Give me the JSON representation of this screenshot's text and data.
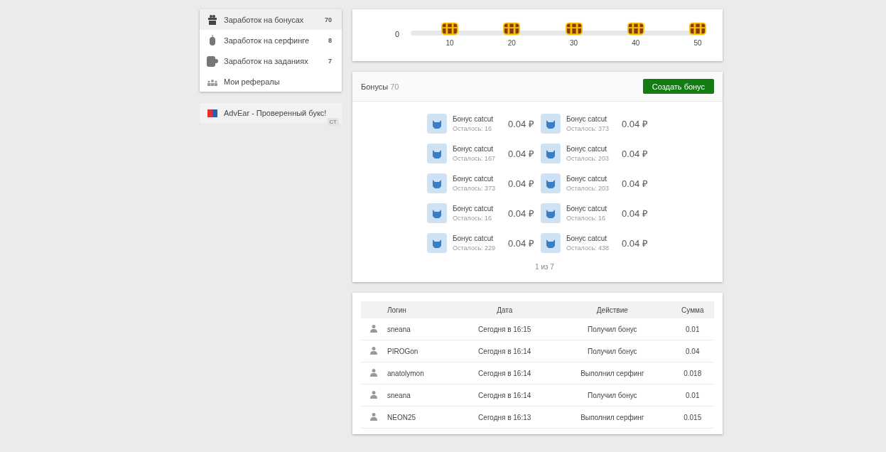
{
  "sidebar": {
    "items": [
      {
        "kind": "gift",
        "label": "Заработок на бонусах",
        "count": "70",
        "selected": true
      },
      {
        "kind": "mouse",
        "label": "Заработок на серфинге",
        "count": "8",
        "selected": false
      },
      {
        "kind": "cup",
        "label": "Заработок на заданиях",
        "count": "7",
        "selected": false
      },
      {
        "kind": "people",
        "label": "Мои рефералы",
        "selected": false
      }
    ]
  },
  "ad": {
    "text": "AdvEar - Проверенный букс!",
    "tag": "СТ"
  },
  "progress": {
    "start": "0",
    "milestones": [
      "10",
      "20",
      "30",
      "40",
      "50"
    ]
  },
  "bonuses": {
    "title": "Бонусы",
    "count": "70",
    "create_button": "Создать бонус",
    "pagination": "1 из 7",
    "items": [
      {
        "name": "Бонус catcut",
        "remaining": "Осталось: 16",
        "price": "0.04 ₽"
      },
      {
        "name": "Бонус catcut",
        "remaining": "Осталось: 373",
        "price": "0.04 ₽"
      },
      {
        "name": "Бонус catcut",
        "remaining": "Осталось: 167",
        "price": "0.04 ₽"
      },
      {
        "name": "Бонус catcut",
        "remaining": "Осталось: 203",
        "price": "0.04 ₽"
      },
      {
        "name": "Бонус catcut",
        "remaining": "Осталось: 373",
        "price": "0.04 ₽"
      },
      {
        "name": "Бонус catcut",
        "remaining": "Осталось: 203",
        "price": "0.04 ₽"
      },
      {
        "name": "Бонус catcut",
        "remaining": "Осталось: 16",
        "price": "0.04 ₽"
      },
      {
        "name": "Бонус catcut",
        "remaining": "Осталось: 16",
        "price": "0.04 ₽"
      },
      {
        "name": "Бонус catcut",
        "remaining": "Осталось: 229",
        "price": "0.04 ₽"
      },
      {
        "name": "Бонус catcut",
        "remaining": "Осталось: 438",
        "price": "0.04 ₽"
      }
    ]
  },
  "table": {
    "columns": [
      "Логин",
      "Дата",
      "Действие",
      "Сумма"
    ],
    "rows": [
      [
        "sneana",
        "Сегодня в 16:15",
        "Получил бонус",
        "0.01"
      ],
      [
        "PIROGon",
        "Сегодня в 16:14",
        "Получил бонус",
        "0.04"
      ],
      [
        "anatolymon",
        "Сегодня в 16:14",
        "Выполнил серфинг",
        "0.018"
      ],
      [
        "sneana",
        "Сегодня в 16:14",
        "Получил бонус",
        "0.01"
      ],
      [
        "NEON25",
        "Сегодня в 16:13",
        "Выполнил серфинг",
        "0.015"
      ]
    ]
  }
}
